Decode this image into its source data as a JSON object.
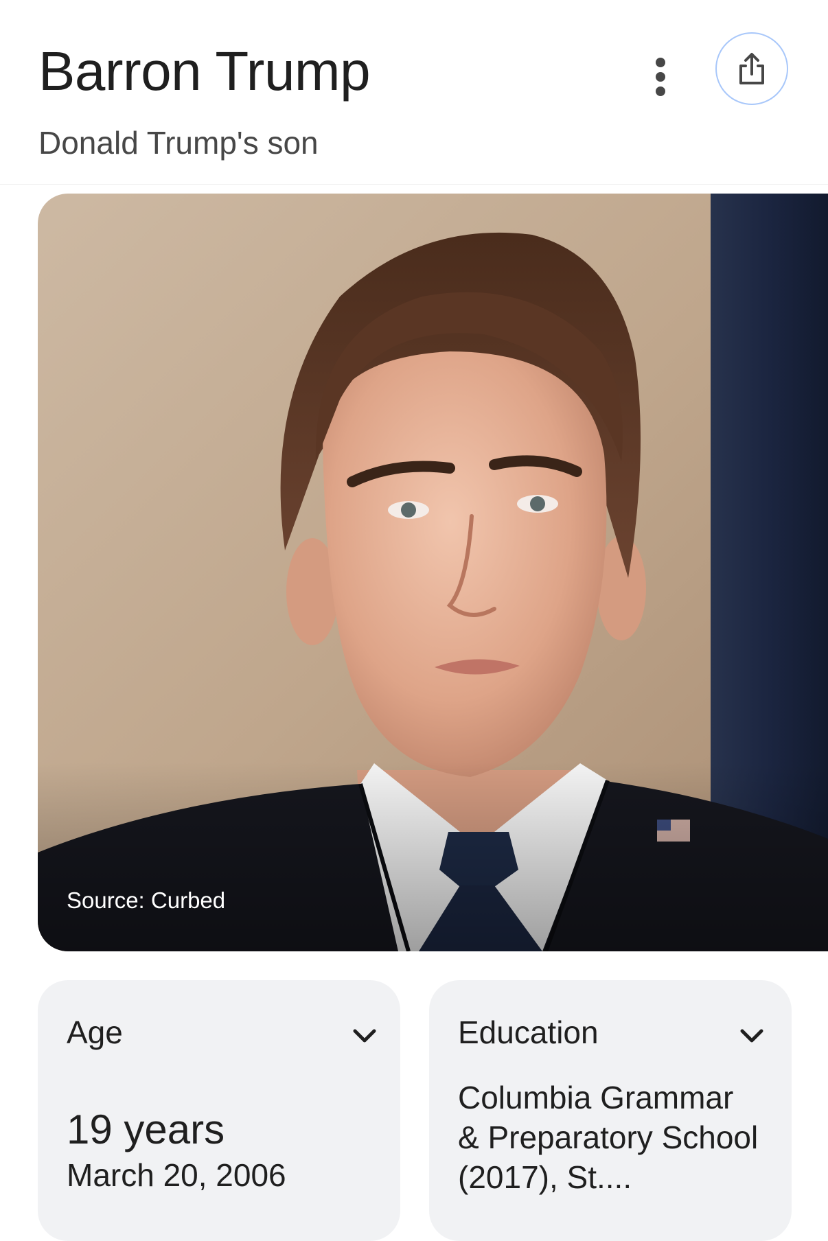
{
  "header": {
    "title": "Barron Trump",
    "subtitle": "Donald Trump's son",
    "more_icon": "more-vert-icon",
    "share_icon": "share-icon"
  },
  "photo": {
    "source": "Source: Curbed"
  },
  "cards": {
    "age": {
      "label": "Age",
      "value": "19 years",
      "date": "March 20, 2006"
    },
    "education": {
      "label": "Education",
      "value": "Columbia Grammar & Preparatory School (2017), St...."
    }
  },
  "colors": {
    "accent_border": "#a8c7fa",
    "card_bg": "#f1f2f4",
    "text_primary": "#1f1f1f",
    "text_secondary": "#474747"
  }
}
